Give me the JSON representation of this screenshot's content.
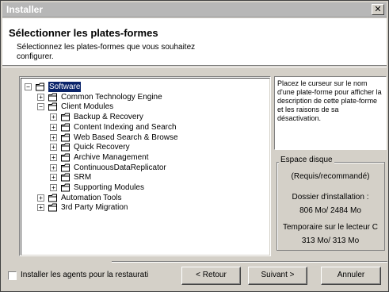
{
  "window": {
    "title": "Installer",
    "close_label": "✕"
  },
  "header": {
    "title": "Sélectionner les plates-formes",
    "subtitle": "Sélectionnez les plates-formes que vous souhaitez configurer."
  },
  "tree": {
    "items": [
      {
        "label": "Software",
        "expander": "−",
        "selected": true
      },
      {
        "label": "Common Technology Engine",
        "expander": "+"
      },
      {
        "label": "Client Modules",
        "expander": "−"
      },
      {
        "label": "Backup & Recovery",
        "expander": "+"
      },
      {
        "label": "Content Indexing and Search",
        "expander": "+"
      },
      {
        "label": "Web Based Search & Browse",
        "expander": "+"
      },
      {
        "label": "Quick Recovery",
        "expander": "+"
      },
      {
        "label": "Archive Management",
        "expander": "+"
      },
      {
        "label": "ContinuousDataReplicator",
        "expander": "+"
      },
      {
        "label": "SRM",
        "expander": "+"
      },
      {
        "label": "Supporting Modules",
        "expander": "+"
      },
      {
        "label": "Automation Tools",
        "expander": "+"
      },
      {
        "label": "3rd Party Migration",
        "expander": "+"
      }
    ]
  },
  "description": "Placez le curseur sur le nom d'une plate-forme pour afficher la description de cette plate-forme et les raisons de sa désactivation.",
  "disk": {
    "legend": "Espace disque",
    "required_label": "(Requis/recommandé)",
    "install_folder_label": "Dossier d'installation :",
    "install_folder_value": "806 Mo/ 2484 Mo",
    "temp_label": "Temporaire sur le lecteur C",
    "temp_value": "313 Mo/ 313 Mo"
  },
  "footer": {
    "checkbox_label": "Installer les agents pour la restaurati",
    "back_label": "< Retour",
    "next_label": "Suivant >",
    "cancel_label": "Annuler"
  }
}
